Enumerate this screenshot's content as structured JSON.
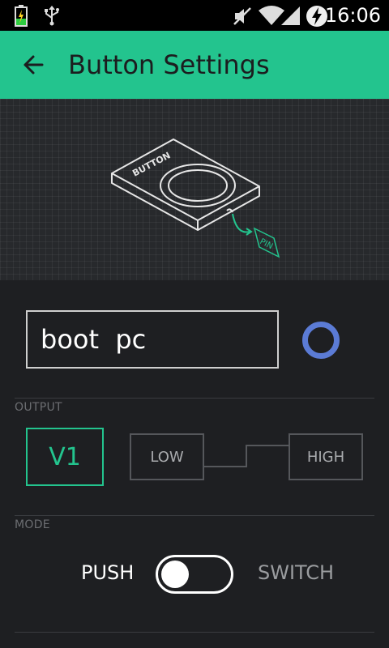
{
  "status_bar": {
    "time": "16:06",
    "icons": [
      "battery-charging-icon",
      "usb-icon",
      "mute-icon",
      "wifi-icon",
      "signal-icon",
      "battery-bolt-icon"
    ]
  },
  "app_bar": {
    "title": "Button Settings",
    "back_icon": "arrow-left-icon"
  },
  "illustration": {
    "button_text": "BUTTON",
    "pin_text": "PIN"
  },
  "name_field": {
    "value": "boot  pc"
  },
  "colors": {
    "accent": "#23c48e",
    "widget_color": "#5b7bd6",
    "background": "#1e1f22"
  },
  "output": {
    "section_label": "OUTPUT",
    "pin": "V1",
    "low_label": "LOW",
    "high_label": "HIGH"
  },
  "mode": {
    "section_label": "MODE",
    "push_label": "PUSH",
    "switch_label": "SWITCH",
    "selected": "PUSH"
  }
}
